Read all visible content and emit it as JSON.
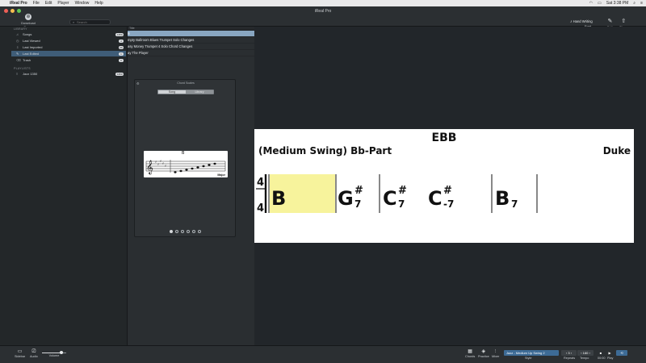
{
  "menubar": {
    "app_name": "iReal Pro",
    "items": [
      "File",
      "Edit",
      "Player",
      "Window",
      "Help"
    ],
    "clock": "Sat 3:38 PM"
  },
  "window": {
    "title": "iReal Pro"
  },
  "toolbar": {
    "download_label": "Download Songs",
    "search_placeholder": "Search",
    "hand_writing": "Hand Writing",
    "font_label": "Font",
    "edit_label": "Edit",
    "share_label": "Share"
  },
  "sidebar": {
    "library_header": "LIBRARY",
    "items": [
      {
        "label": "Songs",
        "count": "1350",
        "icon": "music-note-icon"
      },
      {
        "label": "Last Viewed",
        "count": "4",
        "icon": "clock-icon"
      },
      {
        "label": "Last Imported",
        "count": "40",
        "icon": "import-icon"
      },
      {
        "label": "Last Edited",
        "count": "1",
        "icon": "pencil-icon"
      },
      {
        "label": "Trash",
        "count": "0",
        "icon": "trash-icon"
      }
    ],
    "playlists_header": "PLAYLISTS",
    "playlists": [
      {
        "label": "Jazz 1350",
        "count": "1350"
      }
    ]
  },
  "song_list": {
    "column_header": "Title",
    "rows": [
      "B",
      "mpty Ballroom Blues Trumpet Solo Changes",
      "asy Money Trumpet 4 Solo Chord Changes",
      "ay The Player"
    ]
  },
  "chord_scales": {
    "title": "Chord Scales",
    "tab_song": "Song",
    "tab_library": "Library",
    "staff_chord": "B",
    "scale_label": "Major",
    "pages": 6,
    "active_page": 1
  },
  "chart": {
    "title": "EBB",
    "style": "(Medium Swing) Bb-Part",
    "composer": "Duke",
    "time_sig_top": "4",
    "time_sig_bottom": "4",
    "chords": [
      {
        "root": "B",
        "accidental": "",
        "quality": ""
      },
      {
        "root": "G",
        "accidental": "#",
        "quality": "7"
      },
      {
        "root": "C",
        "accidental": "#",
        "quality": "7"
      },
      {
        "root": "C",
        "accidental": "#",
        "quality": "-7"
      },
      {
        "root": "B",
        "accidental": "",
        "quality": "7"
      }
    ],
    "highlight_color": "#f7f39c"
  },
  "bottombar": {
    "sidebar_label": "Sidebar",
    "audio_label": "Audio",
    "volume_label": "Volume",
    "volume_level": 0.8,
    "chords_label": "Chords",
    "practice_label": "Practice",
    "mixer_label": "Mixer",
    "style_value": "Jazz - Medium Up Swing 2",
    "style_label": "Style",
    "repeats_value": "3",
    "repeats_label": "Repeats",
    "tempo_value": "160",
    "tempo_label": "Tempo",
    "time_value": "00:00",
    "play_label": "Play"
  }
}
